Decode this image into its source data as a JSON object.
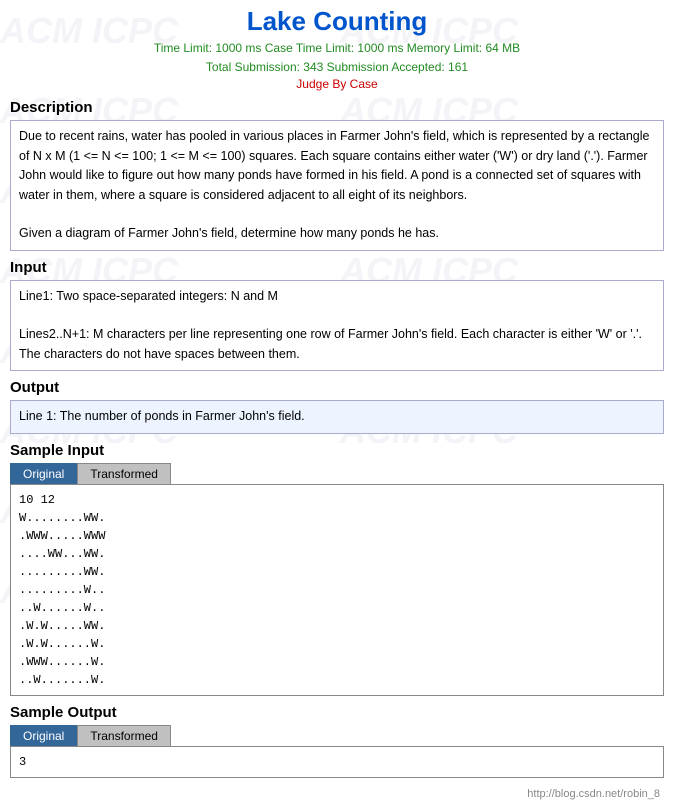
{
  "header": {
    "title": "Lake Counting",
    "meta1": "Time Limit: 1000 ms   Case Time Limit: 1000 ms   Memory Limit: 64 MB",
    "meta2": "Total Submission: 343   Submission Accepted: 161",
    "meta3": "Judge By Case"
  },
  "description": {
    "label": "Description",
    "text1": "Due to recent rains, water has pooled in various places in Farmer John's field, which is represented by a rectangle of N x M (1 <= N <= 100; 1 <= M <= 100) squares. Each square contains either water ('W') or dry land ('.'). Farmer John would like to figure out how many ponds have formed in his field. A pond is a connected set of squares with water in them, where a square is considered adjacent to all eight of its neighbors.",
    "text2": "Given a diagram of Farmer John's field, determine how many ponds he has."
  },
  "input": {
    "label": "Input",
    "line1": "Line1: Two space-separated integers: N and M",
    "line2": "Lines2..N+1: M characters per line representing one row of Farmer John's field. Each character is either 'W' or '.'. The characters do not have spaces between them."
  },
  "output": {
    "label": "Output",
    "text": "Line 1: The number of ponds in Farmer John's field."
  },
  "sampleInput": {
    "label": "Sample Input",
    "tabs": [
      "Original",
      "Transformed"
    ],
    "activeTab": 0,
    "content": "10 12\nW........WW.\n.WWW.....WWW\n....WW...WW.\n.........WW.\n.........W..\n..W......W..\n.W.W.....WW.\n.W.W......W.\n.WWW......W.\n..W.......W."
  },
  "sampleOutput": {
    "label": "Sample Output",
    "tabs": [
      "Original",
      "Transformed"
    ],
    "activeTab": 0,
    "content": "3"
  },
  "footer": {
    "url": "http://blog.csdn.net/robin_8"
  },
  "watermarks": [
    "ACM",
    "ICPC"
  ]
}
